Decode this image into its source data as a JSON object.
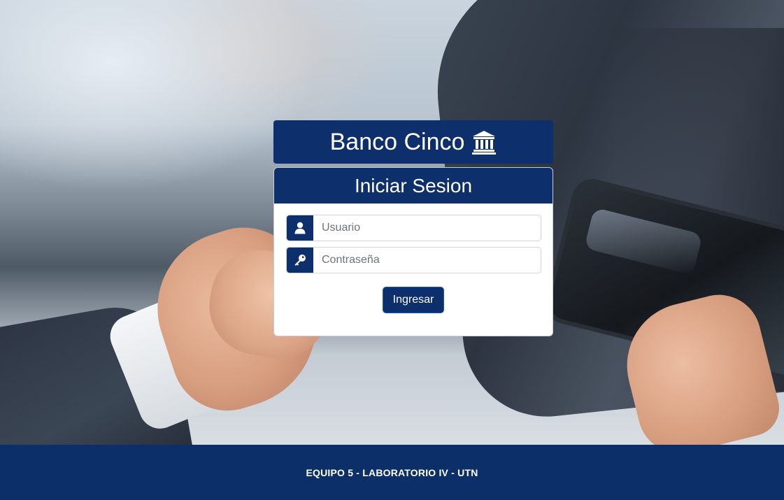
{
  "brand": {
    "name": "Banco Cinco",
    "icon": "bank-icon"
  },
  "login": {
    "title": "Iniciar Sesion",
    "username": {
      "icon": "user-icon",
      "placeholder": "Usuario",
      "value": ""
    },
    "password": {
      "icon": "key-icon",
      "placeholder": "Contraseña",
      "value": ""
    },
    "submit_label": "Ingresar"
  },
  "footer": {
    "text": "EQUIPO 5 - LABORATORIO IV - UTN"
  },
  "colors": {
    "primary": "#0d2f6b",
    "footer": "#0c2f69",
    "card_background": "#ffffff"
  }
}
